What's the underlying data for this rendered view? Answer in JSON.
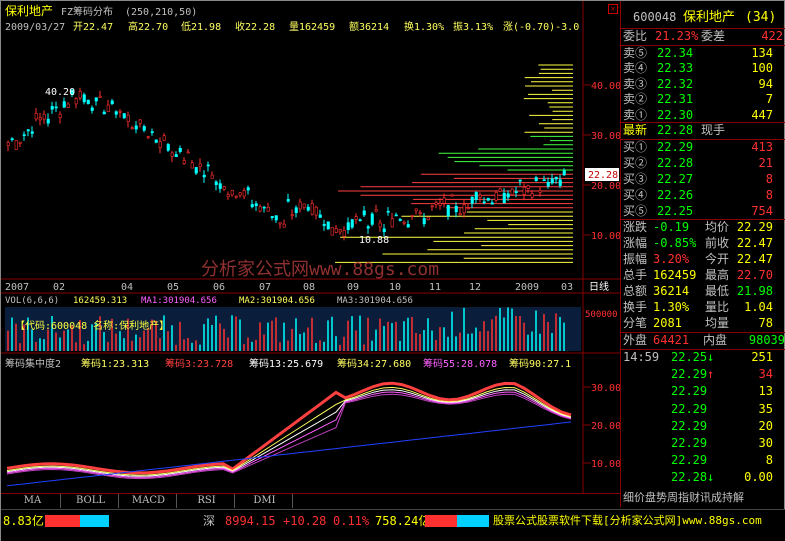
{
  "title": {
    "name": "保利地产",
    "indicator": "FZ筹码分布",
    "params": "(250,210,50)"
  },
  "ohlc": {
    "date": "2009/03/27",
    "open": "开22.47",
    "high": "高22.70",
    "low": "低21.98",
    "close": "收22.28",
    "vol": "量162459",
    "amount": "额36214",
    "turnover": "换1.30%",
    "amp": "振3.13%",
    "chg": "涨(-0.70)-3.0"
  },
  "price_axis": [
    "40.00",
    "30.00",
    "20.00",
    "10.00"
  ],
  "annot": {
    "hi": "40.20",
    "lo": "10.88",
    "cur": "22.28"
  },
  "watermark": "分析家公式网www.88gs.com",
  "dates": [
    "2007",
    "02",
    "04",
    "05",
    "06",
    "07",
    "08",
    "09",
    "10",
    "11",
    "12",
    "2009",
    "03",
    "日线"
  ],
  "vol_header": {
    "label": "VOL(6,6,6)",
    "v": "162459.313",
    "ma1": "MA1:301904.656",
    "ma2": "MA2:301904.656",
    "ma3": "MA3:301904.656"
  },
  "vol_axis": "500000",
  "vol_info": "【代码:600048 名称:保利地产】",
  "chip_header": {
    "label": "筹码集中度2",
    "c1": "筹码1:23.313",
    "c3": "筹码3:23.728",
    "c13": "筹码13:25.679",
    "c34": "筹码34:27.680",
    "c55": "筹码55:28.078",
    "c90": "筹码90:27.1"
  },
  "chip_axis": [
    "30.00",
    "20.00",
    "10.00"
  ],
  "tabs": [
    "MA",
    "BOLL",
    "MACD",
    "RSI",
    "DMI"
  ],
  "stock": {
    "code": "600048",
    "name": "保利地产",
    "num": "(34)"
  },
  "weibi": {
    "l1": "委比",
    "v1": "21.23%",
    "l2": "委差",
    "v2": "422"
  },
  "sell": [
    {
      "l": "卖⑤",
      "p": "22.34",
      "q": "134"
    },
    {
      "l": "卖④",
      "p": "22.33",
      "q": "100"
    },
    {
      "l": "卖③",
      "p": "22.32",
      "q": "94"
    },
    {
      "l": "卖②",
      "p": "22.31",
      "q": "7"
    },
    {
      "l": "卖①",
      "p": "22.30",
      "q": "447"
    }
  ],
  "latest": {
    "l": "最新",
    "p": "22.28",
    "t": "现手"
  },
  "buy": [
    {
      "l": "买①",
      "p": "22.29",
      "q": "413"
    },
    {
      "l": "买②",
      "p": "22.28",
      "q": "21"
    },
    {
      "l": "买③",
      "p": "22.27",
      "q": "8"
    },
    {
      "l": "买④",
      "p": "22.26",
      "q": "8"
    },
    {
      "l": "买⑤",
      "p": "22.25",
      "q": "754"
    }
  ],
  "stats": [
    {
      "l1": "涨跌",
      "v1": "-0.19",
      "l2": "均价",
      "v2": "22.29"
    },
    {
      "l1": "涨幅",
      "v1": "-0.85%",
      "l2": "前收",
      "v2": "22.47"
    },
    {
      "l1": "振幅",
      "v1": "3.20%",
      "l2": "今开",
      "v2": "22.47"
    },
    {
      "l1": "总手",
      "v1": "162459",
      "l2": "最高",
      "v2": "22.70"
    },
    {
      "l1": "总额",
      "v1": "36214",
      "l2": "最低",
      "v2": "21.98"
    },
    {
      "l1": "换手",
      "v1": "1.30%",
      "l2": "量比",
      "v2": "1.04"
    },
    {
      "l1": "分笔",
      "v1": "2081",
      "l2": "均量",
      "v2": "78"
    }
  ],
  "outin": {
    "l1": "外盘",
    "v1": "64421",
    "l2": "内盘",
    "v2": "98039"
  },
  "ticks": [
    {
      "t": "14:59",
      "p": "22.25",
      "a": "↓",
      "q": "251"
    },
    {
      "t": "",
      "p": "22.29",
      "a": "↑",
      "q": "34"
    },
    {
      "t": "",
      "p": "22.29",
      "a": "",
      "q": "13"
    },
    {
      "t": "",
      "p": "22.29",
      "a": "",
      "q": "35"
    },
    {
      "t": "",
      "p": "22.29",
      "a": "",
      "q": "20"
    },
    {
      "t": "",
      "p": "22.29",
      "a": "",
      "q": "30"
    },
    {
      "t": "",
      "p": "22.29",
      "a": "",
      "q": "8"
    },
    {
      "t": "",
      "p": "22.28",
      "a": "↓",
      "q": "0.00"
    }
  ],
  "right_tabs": "细价盘势周指财讯成持解",
  "status": {
    "left": "8.83亿",
    "sz": "深",
    "idx": "8994.15",
    "chg": "+10.28",
    "pct": "0.11%",
    "amt": "758.24亿",
    "ad": "股票公式股票软件下载[分析家公式网]www.88gs.com"
  }
}
